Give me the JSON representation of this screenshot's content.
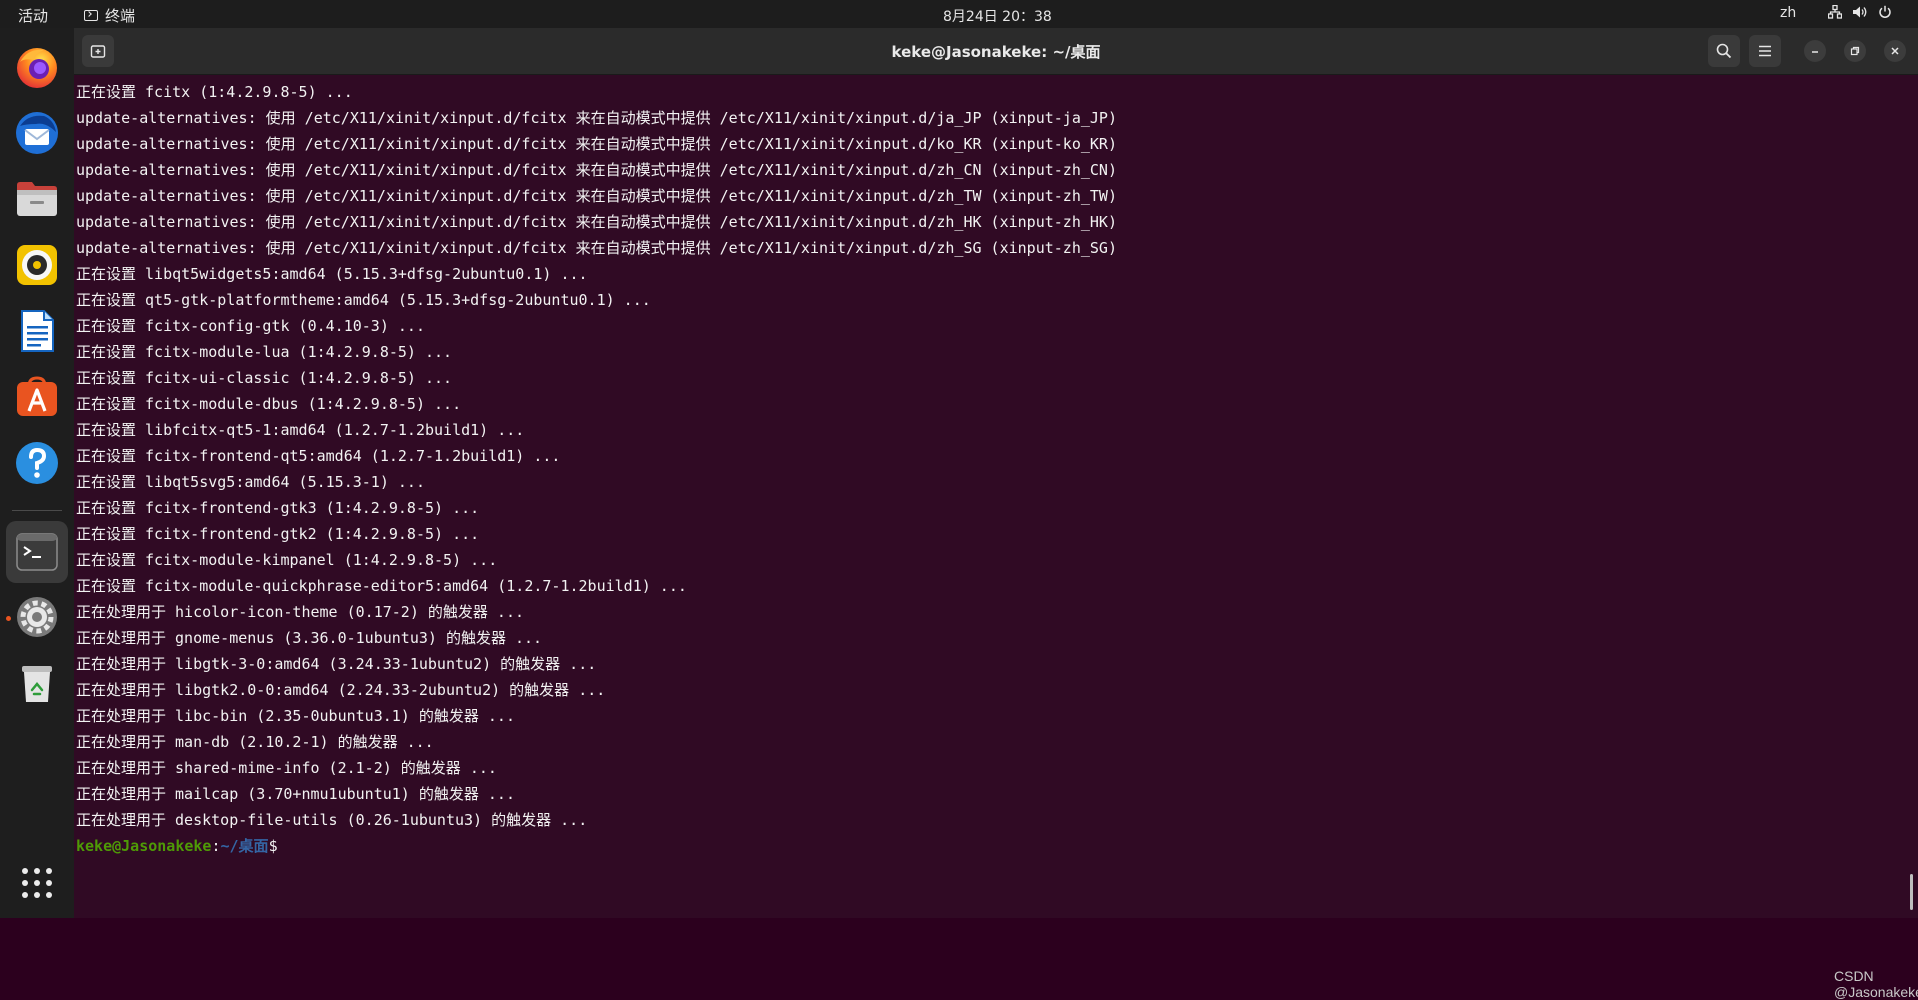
{
  "topbar": {
    "activities": "活动",
    "app_name": "终端",
    "clock": "8月24日  20：38",
    "lang": "zh"
  },
  "dock": {
    "apps": [
      {
        "name": "firefox-icon"
      },
      {
        "name": "thunderbird-icon"
      },
      {
        "name": "files-icon"
      },
      {
        "name": "rhythmbox-icon"
      },
      {
        "name": "libreoffice-writer-icon"
      },
      {
        "name": "app-center-icon"
      },
      {
        "name": "help-icon"
      },
      {
        "name": "terminal-icon"
      },
      {
        "name": "settings-icon"
      },
      {
        "name": "trash-icon"
      },
      {
        "name": "show-apps-icon"
      }
    ]
  },
  "window": {
    "title": "keke@Jasonakeke: ~/桌面"
  },
  "terminal": {
    "lines": [
      "正在设置 fcitx (1:4.2.9.8-5) ...",
      "update-alternatives: 使用 /etc/X11/xinit/xinput.d/fcitx 来在自动模式中提供 /etc/X11/xinit/xinput.d/ja_JP (xinput-ja_JP)",
      "update-alternatives: 使用 /etc/X11/xinit/xinput.d/fcitx 来在自动模式中提供 /etc/X11/xinit/xinput.d/ko_KR (xinput-ko_KR)",
      "update-alternatives: 使用 /etc/X11/xinit/xinput.d/fcitx 来在自动模式中提供 /etc/X11/xinit/xinput.d/zh_CN (xinput-zh_CN)",
      "update-alternatives: 使用 /etc/X11/xinit/xinput.d/fcitx 来在自动模式中提供 /etc/X11/xinit/xinput.d/zh_TW (xinput-zh_TW)",
      "update-alternatives: 使用 /etc/X11/xinit/xinput.d/fcitx 来在自动模式中提供 /etc/X11/xinit/xinput.d/zh_HK (xinput-zh_HK)",
      "update-alternatives: 使用 /etc/X11/xinit/xinput.d/fcitx 来在自动模式中提供 /etc/X11/xinit/xinput.d/zh_SG (xinput-zh_SG)",
      "正在设置 libqt5widgets5:amd64 (5.15.3+dfsg-2ubuntu0.1) ...",
      "正在设置 qt5-gtk-platformtheme:amd64 (5.15.3+dfsg-2ubuntu0.1) ...",
      "正在设置 fcitx-config-gtk (0.4.10-3) ...",
      "正在设置 fcitx-module-lua (1:4.2.9.8-5) ...",
      "正在设置 fcitx-ui-classic (1:4.2.9.8-5) ...",
      "正在设置 fcitx-module-dbus (1:4.2.9.8-5) ...",
      "正在设置 libfcitx-qt5-1:amd64 (1.2.7-1.2build1) ...",
      "正在设置 fcitx-frontend-qt5:amd64 (1.2.7-1.2build1) ...",
      "正在设置 libqt5svg5:amd64 (5.15.3-1) ...",
      "正在设置 fcitx-frontend-gtk3 (1:4.2.9.8-5) ...",
      "正在设置 fcitx-frontend-gtk2 (1:4.2.9.8-5) ...",
      "正在设置 fcitx-module-kimpanel (1:4.2.9.8-5) ...",
      "正在设置 fcitx-module-quickphrase-editor5:amd64 (1.2.7-1.2build1) ...",
      "正在处理用于 hicolor-icon-theme (0.17-2) 的触发器 ...",
      "正在处理用于 gnome-menus (3.36.0-1ubuntu3) 的触发器 ...",
      "正在处理用于 libgtk-3-0:amd64 (3.24.33-1ubuntu2) 的触发器 ...",
      "正在处理用于 libgtk2.0-0:amd64 (2.24.33-2ubuntu2) 的触发器 ...",
      "正在处理用于 libc-bin (2.35-0ubuntu3.1) 的触发器 ...",
      "正在处理用于 man-db (2.10.2-1) 的触发器 ...",
      "正在处理用于 shared-mime-info (2.1-2) 的触发器 ...",
      "正在处理用于 mailcap (3.70+nmu1ubuntu1) 的触发器 ...",
      "正在处理用于 desktop-file-utils (0.26-1ubuntu3) 的触发器 ..."
    ],
    "prompt": {
      "user": "keke@Jasonakeke",
      "colon": ":",
      "path": "~/桌面",
      "sign": "$"
    }
  },
  "watermark": "CSDN @Jasonakeke",
  "colors": {
    "terminal_bg": "#300a24",
    "accent": "#e95420",
    "prompt_user": "#4e9a06",
    "prompt_path": "#3465a4"
  }
}
